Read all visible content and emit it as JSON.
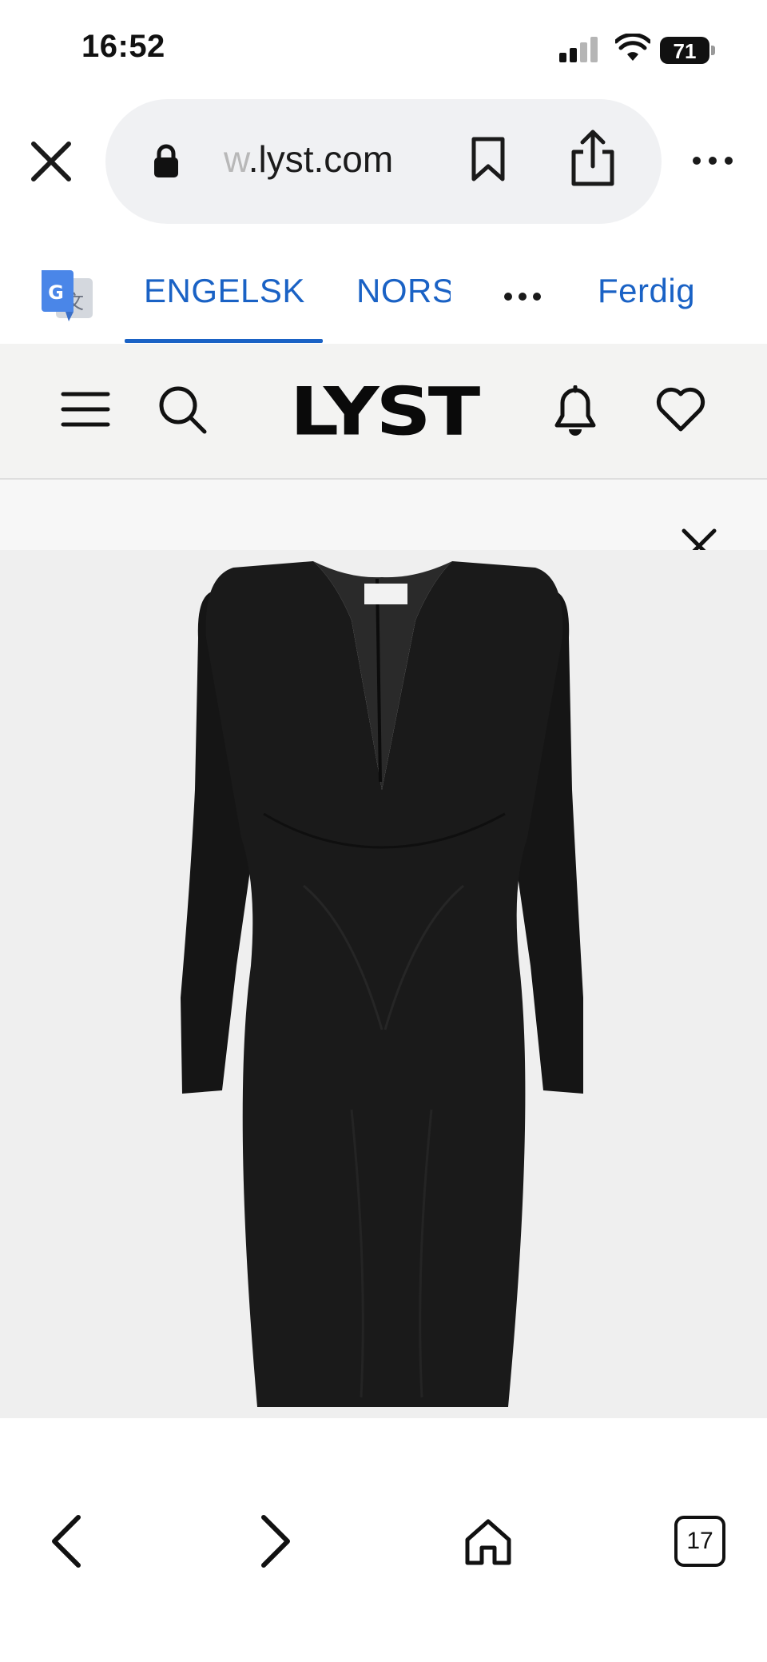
{
  "status_bar": {
    "time": "16:52",
    "battery": "71",
    "icons": [
      "signal-icon",
      "wifi-icon",
      "battery-icon"
    ]
  },
  "browser": {
    "url_faded": "w",
    "url_main": ".lyst.com",
    "icons": [
      "close-icon",
      "lock-icon",
      "bookmark-icon",
      "share-icon",
      "more-icon"
    ]
  },
  "translate_bar": {
    "source_language": "ENGELSK",
    "target_language": "NORS",
    "done_label": "Ferdig",
    "active_tab": "source_language",
    "accent_color": "#1a62c5"
  },
  "site_header": {
    "logo": "LYST",
    "icons": [
      "menu-icon",
      "search-icon",
      "bell-icon",
      "heart-icon"
    ]
  },
  "product": {
    "image_subject": "black long-sleeve deep v-neck dress",
    "background_color": "#efefef"
  },
  "bottom_bar": {
    "tab_count": "17",
    "icons": [
      "back-icon",
      "forward-icon",
      "home-icon",
      "tabs-icon"
    ]
  }
}
